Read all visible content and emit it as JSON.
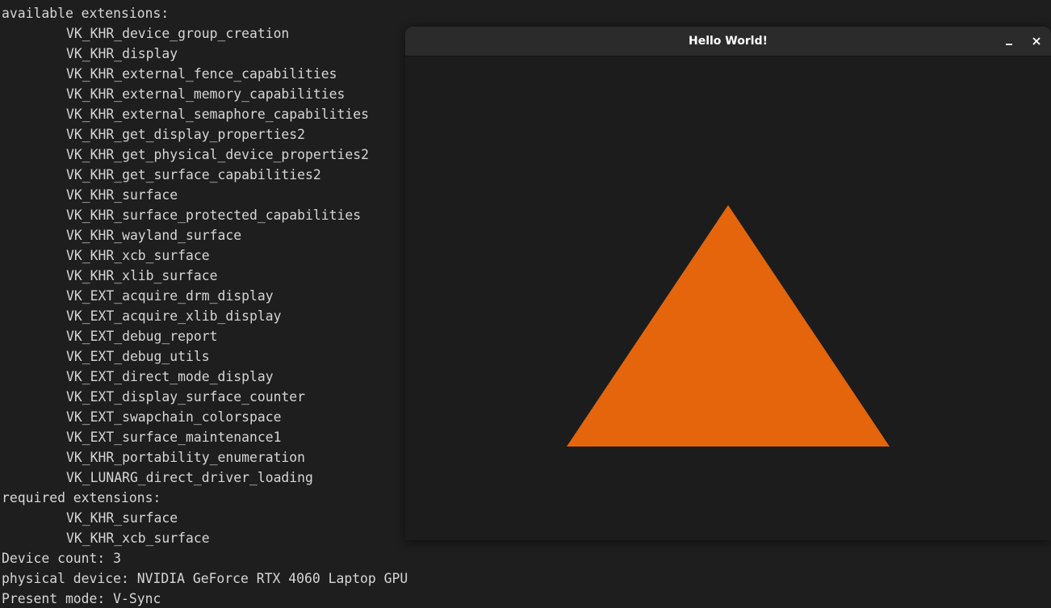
{
  "terminal": {
    "lines": [
      {
        "text": "available extensions:",
        "indent": false
      },
      {
        "text": "VK_KHR_device_group_creation",
        "indent": true
      },
      {
        "text": "VK_KHR_display",
        "indent": true
      },
      {
        "text": "VK_KHR_external_fence_capabilities",
        "indent": true
      },
      {
        "text": "VK_KHR_external_memory_capabilities",
        "indent": true
      },
      {
        "text": "VK_KHR_external_semaphore_capabilities",
        "indent": true
      },
      {
        "text": "VK_KHR_get_display_properties2",
        "indent": true
      },
      {
        "text": "VK_KHR_get_physical_device_properties2",
        "indent": true
      },
      {
        "text": "VK_KHR_get_surface_capabilities2",
        "indent": true
      },
      {
        "text": "VK_KHR_surface",
        "indent": true
      },
      {
        "text": "VK_KHR_surface_protected_capabilities",
        "indent": true
      },
      {
        "text": "VK_KHR_wayland_surface",
        "indent": true
      },
      {
        "text": "VK_KHR_xcb_surface",
        "indent": true
      },
      {
        "text": "VK_KHR_xlib_surface",
        "indent": true
      },
      {
        "text": "VK_EXT_acquire_drm_display",
        "indent": true
      },
      {
        "text": "VK_EXT_acquire_xlib_display",
        "indent": true
      },
      {
        "text": "VK_EXT_debug_report",
        "indent": true
      },
      {
        "text": "VK_EXT_debug_utils",
        "indent": true
      },
      {
        "text": "VK_EXT_direct_mode_display",
        "indent": true
      },
      {
        "text": "VK_EXT_display_surface_counter",
        "indent": true
      },
      {
        "text": "VK_EXT_swapchain_colorspace",
        "indent": true
      },
      {
        "text": "VK_EXT_surface_maintenance1",
        "indent": true
      },
      {
        "text": "VK_KHR_portability_enumeration",
        "indent": true
      },
      {
        "text": "VK_LUNARG_direct_driver_loading",
        "indent": true
      },
      {
        "text": "required extensions:",
        "indent": false
      },
      {
        "text": "VK_KHR_surface",
        "indent": true
      },
      {
        "text": "VK_KHR_xcb_surface",
        "indent": true
      },
      {
        "text": "Device count: 3",
        "indent": false
      },
      {
        "text": "physical device: NVIDIA GeForce RTX 4060 Laptop GPU",
        "indent": false
      },
      {
        "text": "Present mode: V-Sync",
        "indent": false
      }
    ]
  },
  "window": {
    "title": "Hello World!",
    "controls": {
      "minimize_icon": "minimize-icon",
      "close_icon": "close-icon"
    }
  },
  "colors": {
    "terminal_bg": "#1e1e1e",
    "terminal_fg": "#d6d6d6",
    "triangle_fill": "#e4650c",
    "canvas_bg": "#1c1c1c"
  }
}
